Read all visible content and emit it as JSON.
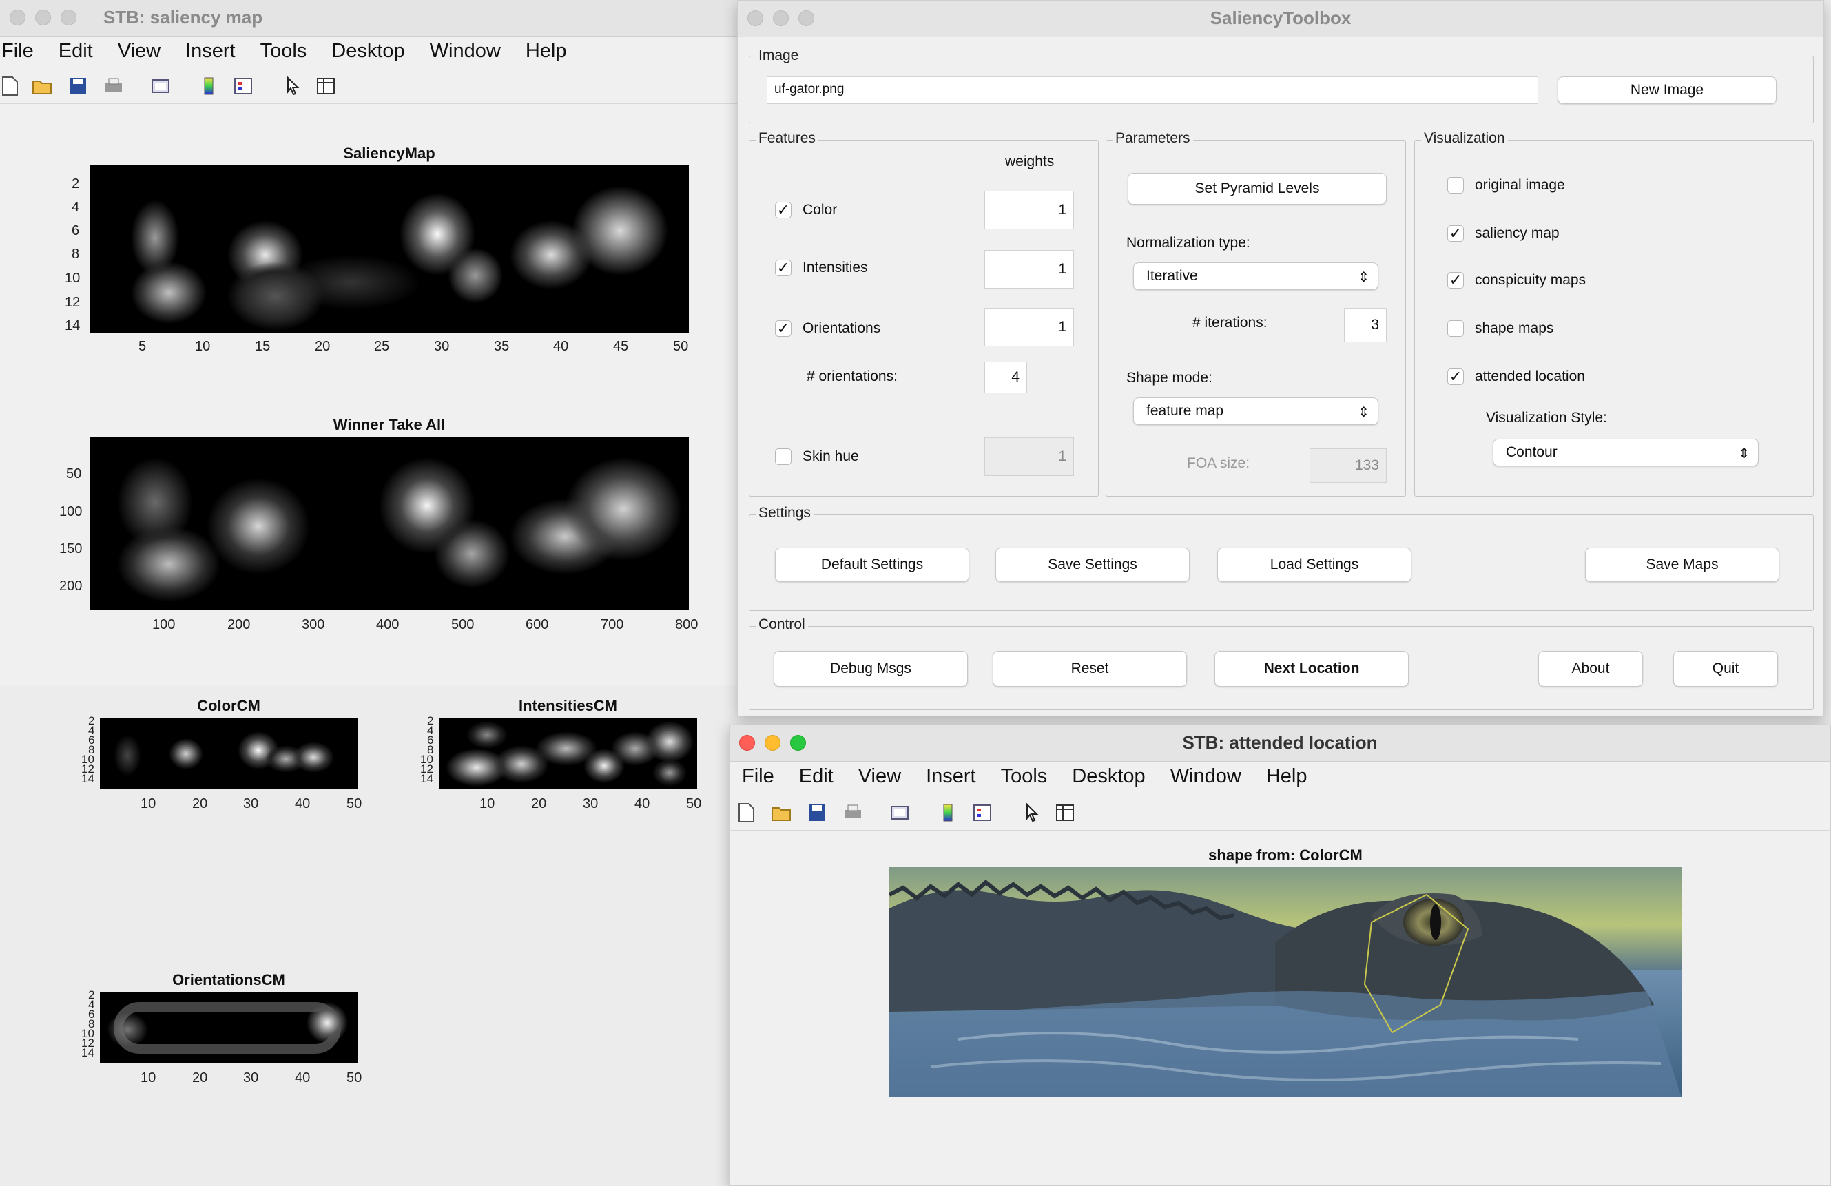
{
  "saliency_window": {
    "title": "STB: saliency map",
    "menu": [
      "File",
      "Edit",
      "View",
      "Insert",
      "Tools",
      "Desktop",
      "Window",
      "Help"
    ],
    "plots": {
      "saliency_map": {
        "title": "SaliencyMap",
        "yticks": [
          "2",
          "4",
          "6",
          "8",
          "10",
          "12",
          "14"
        ],
        "xticks": [
          "5",
          "10",
          "15",
          "20",
          "25",
          "30",
          "35",
          "40",
          "45",
          "50"
        ]
      },
      "winner_take_all": {
        "title": "Winner Take All",
        "yticks": [
          "50",
          "100",
          "150",
          "200"
        ],
        "xticks": [
          "100",
          "200",
          "300",
          "400",
          "500",
          "600",
          "700",
          "800"
        ]
      }
    }
  },
  "conspicuity": {
    "color": {
      "title": "ColorCM",
      "yticks": [
        "2",
        "4",
        "6",
        "8",
        "10",
        "12",
        "14"
      ],
      "xticks": [
        "10",
        "20",
        "30",
        "40",
        "50"
      ]
    },
    "intensities": {
      "title": "IntensitiesCM",
      "yticks": [
        "2",
        "4",
        "6",
        "8",
        "10",
        "12",
        "14"
      ],
      "xticks": [
        "10",
        "20",
        "30",
        "40",
        "50"
      ]
    },
    "orientations": {
      "title": "OrientationsCM",
      "yticks": [
        "2",
        "4",
        "6",
        "8",
        "10",
        "12",
        "14"
      ],
      "xticks": [
        "10",
        "20",
        "30",
        "40",
        "50"
      ]
    }
  },
  "toolbox": {
    "title": "SaliencyToolbox",
    "image": {
      "label": "Image",
      "filename": "uf-gator.png",
      "new_button": "New Image"
    },
    "features": {
      "label": "Features",
      "weights_header": "weights",
      "color": {
        "label": "Color",
        "checked": "✓",
        "weight": "1"
      },
      "intensities": {
        "label": "Intensities",
        "checked": "✓",
        "weight": "1"
      },
      "orientations": {
        "label": "Orientations",
        "checked": "✓",
        "weight": "1"
      },
      "num_orientations": {
        "label": "# orientations:",
        "value": "4"
      },
      "skin_hue": {
        "label": "Skin hue",
        "checked": "",
        "weight": "1"
      }
    },
    "parameters": {
      "label": "Parameters",
      "pyramid_button": "Set Pyramid Levels",
      "normalization_label": "Normalization type:",
      "normalization_value": "Iterative",
      "iterations_label": "# iterations:",
      "iterations_value": "3",
      "shape_mode_label": "Shape mode:",
      "shape_mode_value": "feature map",
      "foa_label": "FOA size:",
      "foa_value": "133"
    },
    "visualization": {
      "label": "Visualization",
      "original_image": {
        "label": "original image",
        "checked": ""
      },
      "saliency_map": {
        "label": "saliency map",
        "checked": "✓"
      },
      "conspicuity_maps": {
        "label": "conspicuity maps",
        "checked": "✓"
      },
      "shape_maps": {
        "label": "shape maps",
        "checked": ""
      },
      "attended_location": {
        "label": "attended location",
        "checked": "✓"
      },
      "style_label": "Visualization Style:",
      "style_value": "Contour"
    },
    "settings": {
      "label": "Settings",
      "default": "Default Settings",
      "save": "Save Settings",
      "load": "Load Settings",
      "save_maps": "Save Maps"
    },
    "control": {
      "label": "Control",
      "debug": "Debug Msgs",
      "reset": "Reset",
      "next": "Next Location",
      "about": "About",
      "quit": "Quit"
    }
  },
  "attended_window": {
    "title": "STB: attended location",
    "menu": [
      "File",
      "Edit",
      "View",
      "Insert",
      "Tools",
      "Desktop",
      "Window",
      "Help"
    ],
    "image_title": "shape from: ColorCM"
  }
}
